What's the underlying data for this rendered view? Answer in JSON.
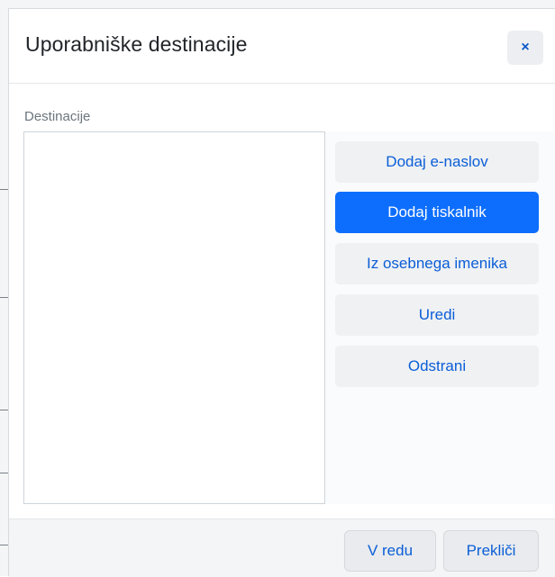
{
  "dialog": {
    "title": "Uporabniške destinacije",
    "close_icon": "×"
  },
  "destinations": {
    "label": "Destinacije",
    "items": []
  },
  "actions": {
    "add_email": "Dodaj e-naslov",
    "add_printer": "Dodaj tiskalnik",
    "from_address_book": "Iz osebnega imenika",
    "edit": "Uredi",
    "remove": "Odstrani"
  },
  "footer": {
    "ok": "V redu",
    "cancel": "Prekliči"
  },
  "colors": {
    "accent": "#0d6efd",
    "link_text": "#0b5ed7",
    "secondary_button": "#eff1f3"
  }
}
